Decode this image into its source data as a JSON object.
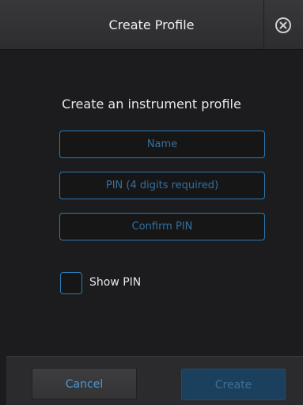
{
  "dialog": {
    "title": "Create Profile",
    "heading": "Create an instrument profile",
    "close_icon": "close-circle-icon"
  },
  "form": {
    "name_placeholder": "Name",
    "name_value": "",
    "pin_placeholder": "PIN (4 digits required)",
    "pin_value": "",
    "confirm_placeholder": "Confirm PIN",
    "confirm_value": "",
    "show_pin_label": "Show PIN",
    "show_pin_checked": false
  },
  "footer": {
    "cancel_label": "Cancel",
    "create_label": "Create",
    "create_enabled": false
  },
  "colors": {
    "accent": "#2b7bb5",
    "background": "#1c1c1e",
    "disabled_button": "#1a405e"
  }
}
